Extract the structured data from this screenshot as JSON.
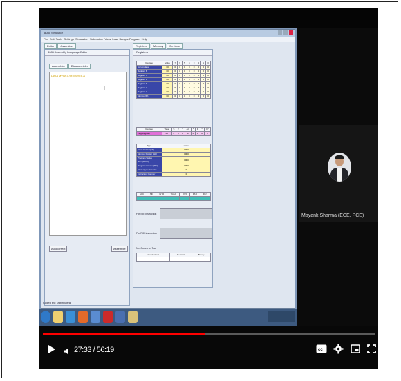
{
  "app": {
    "title": "8085 Simulator",
    "menu": [
      "File",
      "Edit",
      "Tools",
      "Settings",
      "Simulation",
      "Subroutine",
      "View",
      "Load Sample Program",
      "Help"
    ],
    "left_tabs": [
      "Editor",
      "Assembler"
    ],
    "left_panel_title": "8085 Assembly Language Editor",
    "editor_tabs": [
      "Assembler",
      "Disassembler"
    ],
    "editor_code": "DATA MVI  A,07H; MOV B,A",
    "autocorrect_label": "Autocorrect",
    "assemble_label": "Assemble",
    "right_tabs": [
      "Registers",
      "Memory",
      "Devices"
    ],
    "right_panel_title": "Registers",
    "reg_headers": [
      "Register",
      "Value",
      "7",
      "6",
      "5",
      "4",
      "3",
      "2",
      "1",
      "0"
    ],
    "registers": [
      {
        "name": "Accumulator",
        "value": "00"
      },
      {
        "name": "Register B",
        "value": "00"
      },
      {
        "name": "Register C",
        "value": "00"
      },
      {
        "name": "Register D",
        "value": "00"
      },
      {
        "name": "Register E",
        "value": "00"
      },
      {
        "name": "Register H",
        "value": "00"
      },
      {
        "name": "Register L",
        "value": "00"
      },
      {
        "name": "Memory(M)",
        "value": "00"
      }
    ],
    "flag_headers": [
      "Register",
      "Value",
      "S",
      "Z",
      "*",
      "AC",
      "*",
      "P",
      "*",
      "CY"
    ],
    "flag_row": {
      "name": "Flag Register",
      "value": "00"
    },
    "spec_headers": [
      "Type",
      "Value"
    ],
    "special": [
      {
        "name": "Stack Pointer(SP)",
        "value": "0000"
      },
      {
        "name": "Memory Pointer (HL)",
        "value": "0000"
      },
      {
        "name": "Program Status Word(PSW)",
        "value": "0000"
      },
      {
        "name": "Program Counter(PC)",
        "value": "0000"
      },
      {
        "name": "Clock Cycle Counter",
        "value": "0"
      },
      {
        "name": "Instruction Counter",
        "value": "0"
      }
    ],
    "interrupts": [
      "SOD",
      "SID",
      "INTR",
      "TRAP",
      "R7.5",
      "R6.5",
      "R5.5"
    ],
    "sim_label": "For SIM instruction",
    "rim_label": "For RIM instruction",
    "converter_title": "No. Converter Tool",
    "converter_cols": [
      "Hexadecimal",
      "Decimal",
      "Binary"
    ],
    "status_bar": "Coded by : Jubin Mitra"
  },
  "webcam": {
    "name": "Mayank Sharma (ECE, PCE)"
  },
  "player": {
    "time": "27:33 / 56:19",
    "progress": 0.489,
    "icons": [
      "play-icon",
      "volume-icon",
      "cc-icon",
      "settings-icon",
      "miniplayer-icon",
      "fullscreen-icon"
    ]
  }
}
